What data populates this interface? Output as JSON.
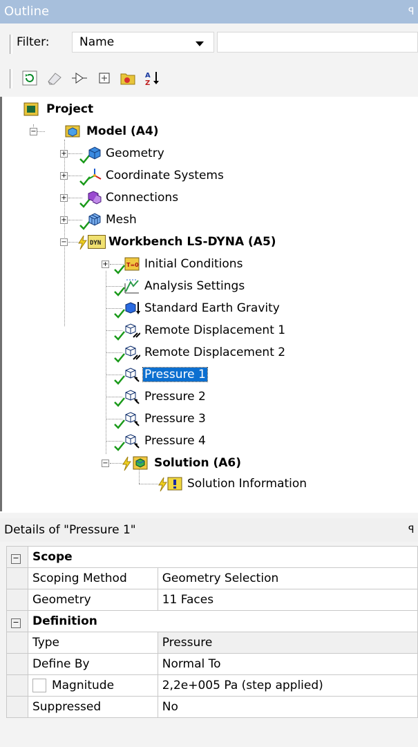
{
  "outline": {
    "title": "Outline",
    "pin_glyph": "ᵖ",
    "filter_label": "Filter:",
    "filter_value": "Name",
    "filter_input_value": "",
    "toolbar_icons": [
      "refresh-icon",
      "eraser-icon",
      "tree-node-icon",
      "expand-all-icon",
      "folder-icon",
      "sort-az-icon"
    ],
    "tree": {
      "project": "Project",
      "model": "Model (A4)",
      "geometry": "Geometry",
      "coordinate_systems": "Coordinate Systems",
      "connections": "Connections",
      "mesh": "Mesh",
      "analysis": "Workbench LS-DYNA (A5)",
      "initial_conditions": "Initial Conditions",
      "analysis_settings": "Analysis Settings",
      "standard_earth_gravity": "Standard Earth Gravity",
      "remote_displacement_1": "Remote Displacement 1",
      "remote_displacement_2": "Remote Displacement 2",
      "pressure_1": "Pressure 1",
      "pressure_2": "Pressure 2",
      "pressure_3": "Pressure 3",
      "pressure_4": "Pressure 4",
      "solution": "Solution (A6)",
      "solution_information": "Solution Information",
      "dyn_badge": "DYN"
    }
  },
  "details": {
    "title": "Details of \"Pressure 1\"",
    "pin_glyph": "ᵖ",
    "sections": {
      "scope": "Scope",
      "definition": "Definition"
    },
    "rows": {
      "scoping_method_label": "Scoping Method",
      "scoping_method_value": "Geometry Selection",
      "geometry_label": "Geometry",
      "geometry_value": "11 Faces",
      "type_label": "Type",
      "type_value": "Pressure",
      "define_by_label": "Define By",
      "define_by_value": "Normal To",
      "magnitude_label": "Magnitude",
      "magnitude_value": "2,2e+005 Pa  (step applied)",
      "suppressed_label": "Suppressed",
      "suppressed_value": "No"
    }
  },
  "colors": {
    "header_blue": "#a7bfdc",
    "selection_blue": "#0b6fd0",
    "check_green": "#1a9a1a"
  }
}
